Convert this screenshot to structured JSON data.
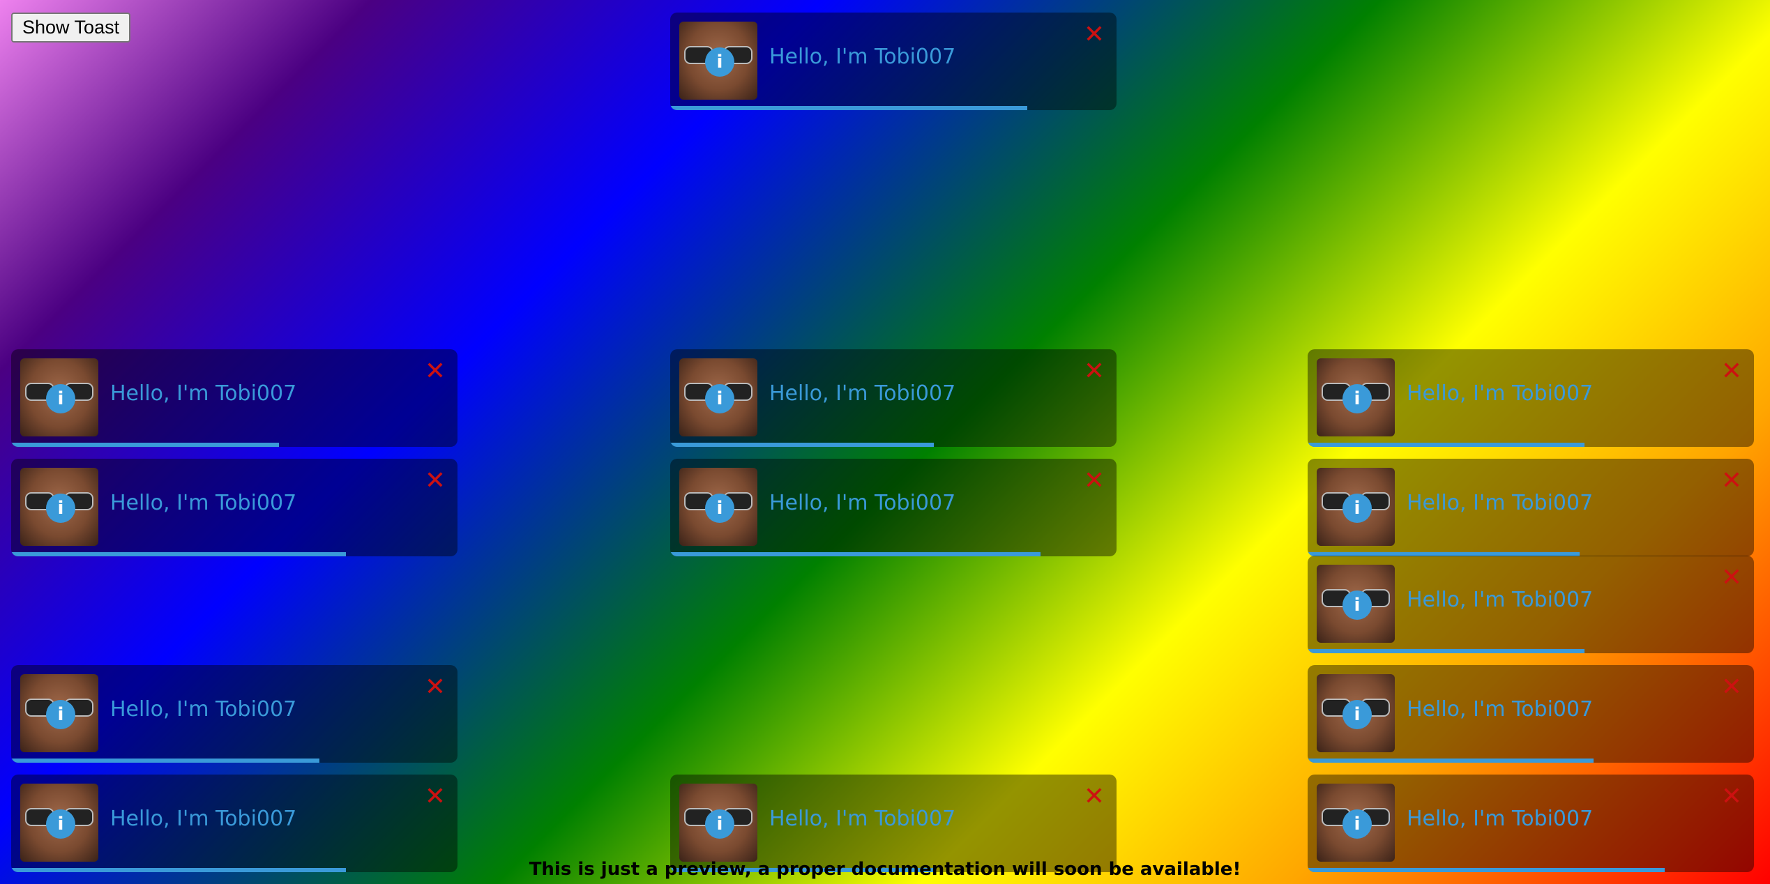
{
  "button": {
    "label": "Show Toast"
  },
  "toast": {
    "message": "Hello, I'm Tobi007",
    "info_icon": "i",
    "close_icon": "✕",
    "accent": "#3a9ad9",
    "close_color": "#cc1111"
  },
  "toasts": [
    {
      "progress": 0.8
    },
    {
      "progress": 0.6
    },
    {
      "progress": 0.75
    },
    {
      "progress": 0.69
    },
    {
      "progress": 0.75
    },
    {
      "progress": 0.59
    },
    {
      "progress": 0.83
    },
    {
      "progress": 0.59
    },
    {
      "progress": 0.62
    },
    {
      "progress": 0.61
    },
    {
      "progress": 0.62
    },
    {
      "progress": 0.64
    }
  ],
  "footer": {
    "text": "This is just a preview, a proper documentation will soon be available!"
  }
}
